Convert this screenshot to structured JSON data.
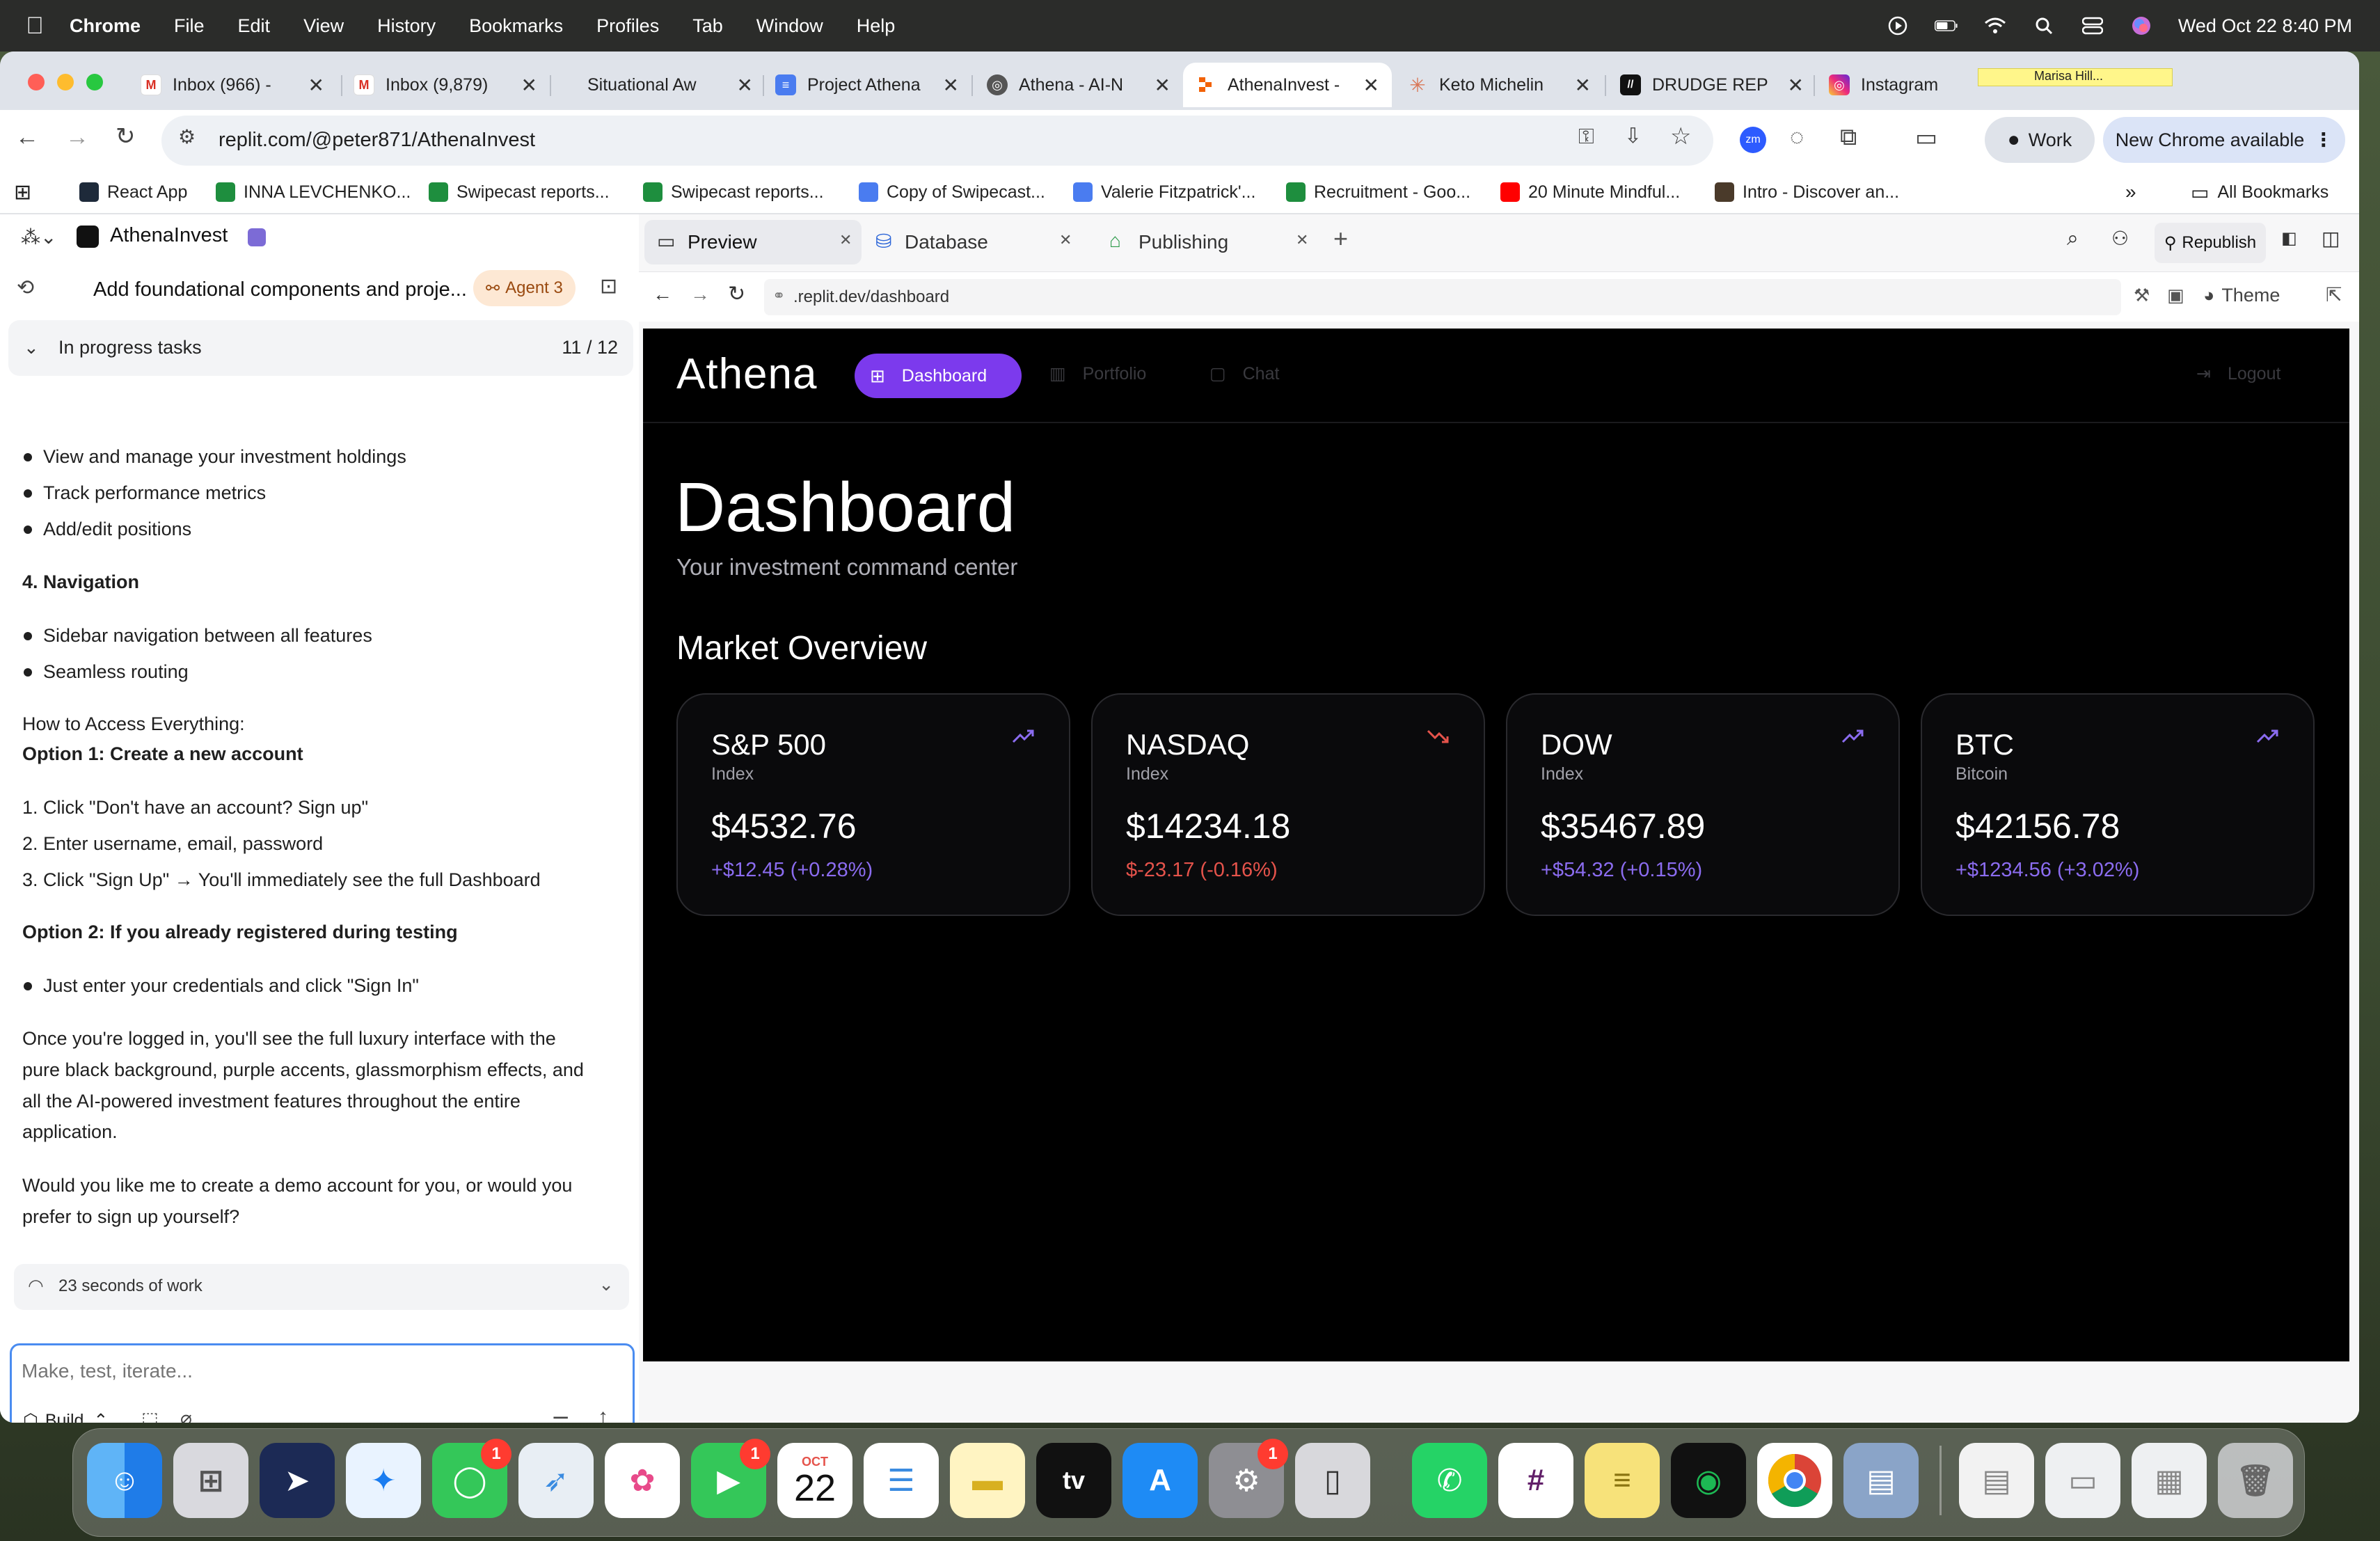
{
  "menubar": {
    "app": "Chrome",
    "items": [
      "File",
      "Edit",
      "View",
      "History",
      "Bookmarks",
      "Profiles",
      "Tab",
      "Window",
      "Help"
    ],
    "datetime": "Wed Oct 22  8:40 PM"
  },
  "tabs": [
    {
      "title": "Inbox (966) - ",
      "icon": "gmail-icon"
    },
    {
      "title": "Inbox (9,879) ",
      "icon": "gmail-icon"
    },
    {
      "title": "Situational Aw",
      "icon": "none"
    },
    {
      "title": "Project Athena",
      "icon": "google-docs-icon"
    },
    {
      "title": "Athena - AI-N",
      "icon": "globe-icon"
    },
    {
      "title": "AthenaInvest -",
      "icon": "replit-icon"
    },
    {
      "title": "Keto Michelin",
      "icon": "claude-icon"
    },
    {
      "title": "DRUDGE REP",
      "icon": "drudge-icon"
    },
    {
      "title": "Instagram",
      "icon": "instagram-icon"
    }
  ],
  "sticky_note": "Marisa Hill...",
  "url": "replit.com/@peter871/AthenaInvest",
  "profile_label": "Work",
  "update_label": "New Chrome available",
  "bookmarks": [
    {
      "label": "React App",
      "color": "#1e2a3a"
    },
    {
      "label": "INNA LEVCHENKO...",
      "color": "#1e8e3e"
    },
    {
      "label": "Swipecast reports...",
      "color": "#1e8e3e"
    },
    {
      "label": "Swipecast reports...",
      "color": "#1e8e3e"
    },
    {
      "label": "Copy of Swipecast...",
      "color": "#4a7cf0"
    },
    {
      "label": "Valerie Fitzpatrick'...",
      "color": "#4a7cf0"
    },
    {
      "label": "Recruitment - Goo...",
      "color": "#1e8e3e"
    },
    {
      "label": "20 Minute Mindful...",
      "color": "#ff0000"
    },
    {
      "label": "Intro - Discover an...",
      "color": "#4a3a2a"
    }
  ],
  "all_bookmarks": "All Bookmarks",
  "replit": {
    "project": "AthenaInvest",
    "chat_title": "Add foundational components and proje...",
    "agent_badge": "Agent 3",
    "progress_label": "In progress tasks",
    "progress_count": "11 / 12",
    "lines": {
      "b1": "View and manage your investment holdings",
      "b2": "Track performance metrics",
      "b3": "Add/edit positions",
      "h4": "4. Navigation",
      "b4": "Sidebar navigation between all features",
      "b5": "Seamless routing",
      "access": "How to Access Everything:",
      "opt1": "Option 1: Create a new account",
      "s1": "1. Click \"Don't have an account? Sign up\"",
      "s2": "2. Enter username, email, password",
      "s3": "3. Click \"Sign Up\" → You'll immediately see the full Dashboard",
      "opt2": "Option 2: If you already registered during testing",
      "b6": "Just enter your credentials and click \"Sign In\"",
      "p1a": "Once you're logged in, you'll see the full luxury interface with the",
      "p1b": "pure black background, purple accents, glassmorphism effects, and",
      "p1c": "all the AI-powered investment features throughout the entire",
      "p1d": "application.",
      "p2a": "Would you like me to create a demo account for you, or would you",
      "p2b": "prefer to sign up yourself?"
    },
    "work_time": "23 seconds of work",
    "input_placeholder": "Make, test, iterate...",
    "build_label": "Build",
    "pane_tabs": [
      "Preview",
      "Database",
      "Publishing"
    ],
    "republish": "Republish",
    "preview_url": ".replit.dev/dashboard",
    "theme_label": "Theme"
  },
  "athena": {
    "logo": "Athena",
    "nav": [
      "Dashboard",
      "Portfolio",
      "Chat"
    ],
    "logout": "Logout",
    "title": "Dashboard",
    "subtitle": "Your investment command center",
    "section": "Market Overview",
    "accent": "#8b5cf6",
    "up_color": "#8b6cf0",
    "down_color": "#e5534b",
    "cards": [
      {
        "name": "S&P 500",
        "type": "Index",
        "price": "$4532.76",
        "change": "+$12.45 (+0.28%)",
        "trend": "up"
      },
      {
        "name": "NASDAQ",
        "type": "Index",
        "price": "$14234.18",
        "change": "$-23.17 (-0.16%)",
        "trend": "down"
      },
      {
        "name": "DOW",
        "type": "Index",
        "price": "$35467.89",
        "change": "+$54.32 (+0.15%)",
        "trend": "up"
      },
      {
        "name": "BTC",
        "type": "Bitcoin",
        "price": "$42156.78",
        "change": "+$1234.56 (+3.02%)",
        "trend": "up"
      }
    ]
  },
  "dock": {
    "calendar_month": "OCT",
    "calendar_day": "22",
    "badges": {
      "messages": "1",
      "facetime": "1",
      "settings": "1"
    }
  }
}
